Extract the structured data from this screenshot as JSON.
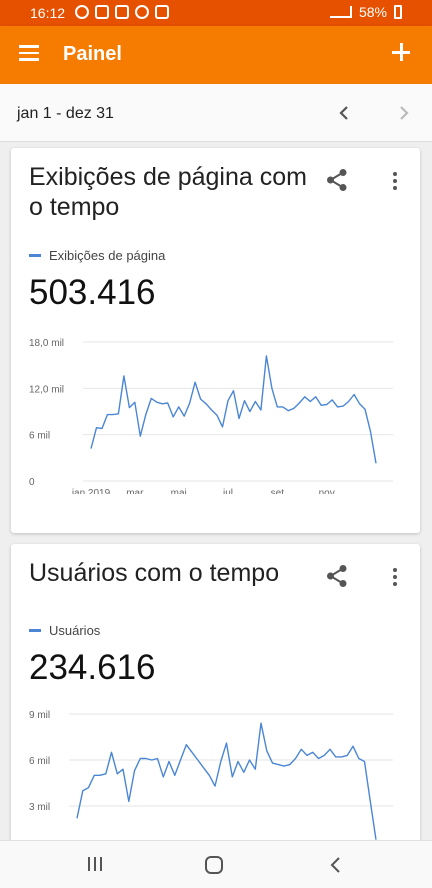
{
  "status_bar": {
    "time": "16:12",
    "battery": "58%",
    "icons": [
      "whatsapp-icon",
      "notification-icon",
      "notification-icon",
      "notification-icon",
      "laptop-icon",
      "mute-icon",
      "wifi-icon",
      "signal-icon",
      "battery-icon"
    ]
  },
  "app_bar": {
    "title": "Painel",
    "menu_icon": "menu-icon",
    "add_icon": "plus-icon",
    "background": "#f57c00"
  },
  "date_range": {
    "label": "jan 1 - dez 31",
    "prev_icon": "chevron-left-icon",
    "next_icon": "chevron-right-icon"
  },
  "cards": [
    {
      "title": "Exibições de página com o tempo",
      "legend": "Exibições de página",
      "total": "503.416",
      "share_icon": "share-icon",
      "more_icon": "more-vert-icon"
    },
    {
      "title": "Usuários com o tempo",
      "legend": "Usuários",
      "total": "234.616",
      "share_icon": "share-icon",
      "more_icon": "more-vert-icon"
    }
  ],
  "chart_data": [
    {
      "type": "line",
      "series": [
        {
          "name": "Exibições de página",
          "color": "#4a86d4"
        }
      ],
      "x": [
        1,
        2,
        3,
        4,
        5,
        6,
        7,
        8,
        9,
        10,
        11,
        12,
        13,
        14,
        15,
        16,
        17,
        18,
        19,
        20,
        21,
        22,
        23,
        24,
        25,
        26,
        27,
        28,
        29,
        30,
        31,
        32,
        33,
        34,
        35,
        36,
        37,
        38,
        39,
        40,
        41,
        42,
        43,
        44,
        45,
        46,
        47,
        48,
        49,
        50,
        51,
        52
      ],
      "values": [
        4.2,
        6.9,
        6.8,
        8.6,
        8.6,
        8.7,
        13.6,
        9.5,
        10.2,
        5.8,
        8.6,
        10.7,
        10.2,
        10.0,
        10.1,
        8.3,
        9.6,
        8.4,
        10.1,
        12.8,
        10.6,
        10.0,
        9.2,
        8.5,
        7.0,
        10.4,
        11.7,
        8.1,
        10.4,
        9.0,
        10.3,
        9.2,
        16.2,
        12.0,
        9.6,
        9.6,
        9.1,
        9.4,
        10.1,
        10.9,
        10.3,
        10.9,
        9.8,
        9.9,
        10.5,
        9.6,
        9.7,
        10.3,
        11.2,
        10.0,
        9.3,
        6.4
      ],
      "x_tick_labels": [
        "jan 2019",
        "mar",
        "mai",
        "jul",
        "set",
        "nov"
      ],
      "x_tick_positions": [
        1,
        9,
        17,
        26,
        35,
        44
      ],
      "y_ticks": [
        0,
        6,
        12,
        18
      ],
      "y_tick_labels": [
        "0",
        "6 mil",
        "12,0 mil",
        "18,0 mil"
      ],
      "ylim": [
        0,
        18
      ],
      "last_value": 2.3,
      "grid": true
    },
    {
      "type": "line",
      "series": [
        {
          "name": "Usuários",
          "color": "#4a86d4"
        }
      ],
      "x": [
        1,
        2,
        3,
        4,
        5,
        6,
        7,
        8,
        9,
        10,
        11,
        12,
        13,
        14,
        15,
        16,
        17,
        18,
        19,
        20,
        21,
        22,
        23,
        24,
        25,
        26,
        27,
        28,
        29,
        30,
        31,
        32,
        33,
        34,
        35,
        36,
        37,
        38,
        39,
        40,
        41,
        42,
        43,
        44,
        45,
        46,
        47,
        48,
        49,
        50,
        51,
        52
      ],
      "values": [
        2.2,
        4.0,
        4.2,
        5.0,
        5.0,
        5.1,
        6.5,
        5.1,
        5.4,
        3.3,
        5.3,
        6.1,
        6.1,
        6.0,
        6.1,
        4.9,
        5.9,
        5.0,
        6.0,
        7.0,
        6.5,
        6.0,
        5.5,
        5.0,
        4.3,
        5.9,
        7.1,
        4.9,
        5.9,
        5.2,
        6.0,
        5.4,
        8.4,
        6.6,
        5.8,
        5.7,
        5.6,
        5.7,
        6.1,
        6.7,
        6.3,
        6.5,
        6.1,
        6.3,
        6.7,
        6.2,
        6.2,
        6.3,
        6.9,
        6.1,
        5.9,
        3.3
      ],
      "y_ticks": [
        3,
        6,
        9
      ],
      "y_tick_labels": [
        "3 mil",
        "6 mil",
        "9 mil"
      ],
      "ylim": [
        0,
        9
      ],
      "last_value": 0.8,
      "grid": true
    }
  ],
  "nav_bar": {
    "recent_icon": "recent-apps-icon",
    "home_icon": "home-icon",
    "back_icon": "back-icon"
  }
}
